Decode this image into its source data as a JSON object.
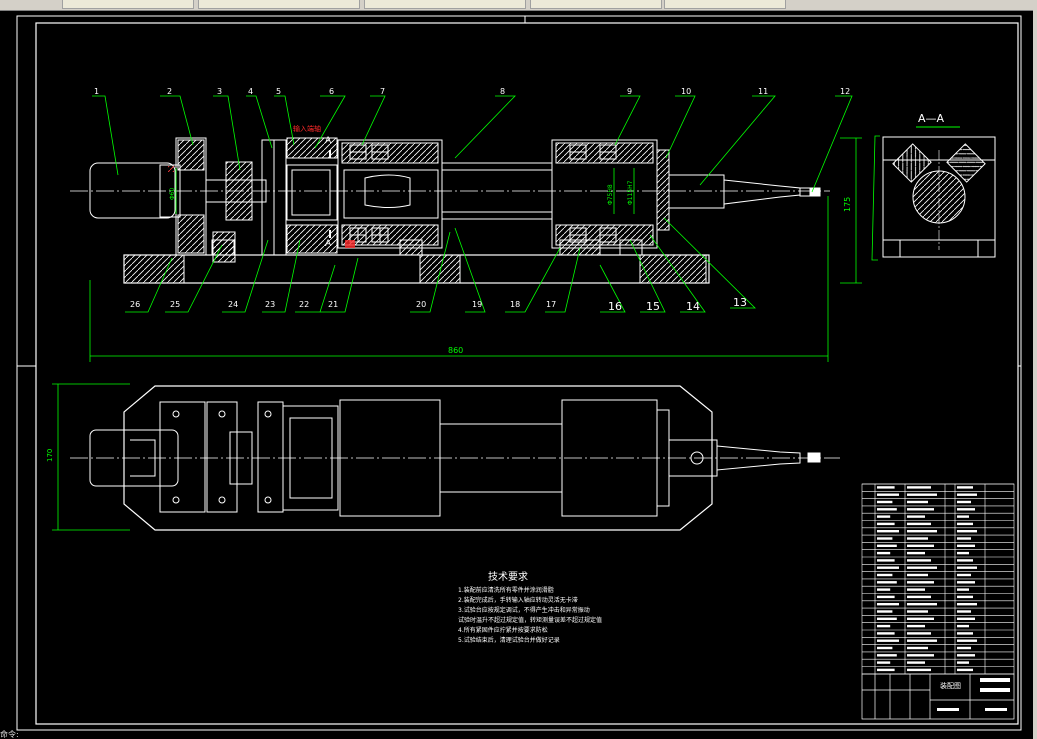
{
  "drawing": {
    "part_numbers": [
      "1",
      "2",
      "3",
      "4",
      "5",
      "6",
      "7",
      "8",
      "9",
      "10",
      "11",
      "12",
      "13",
      "14",
      "15",
      "16",
      "17",
      "18",
      "19",
      "20",
      "21",
      "22",
      "23",
      "24",
      "25",
      "26"
    ],
    "section_mark": "A",
    "section_view_title": "A—A",
    "red_note": "输入端轴",
    "dim_total_length": "860",
    "dim_height": "175",
    "dim_plan_width": "170",
    "dim_diam_1": "Φ60",
    "dim_diam_2": "Φ75H8",
    "dim_diam_3": "Φ115H7"
  },
  "tech_requirements": {
    "title": "技术要求",
    "lines": [
      "1.装配前应清洗所有零件并涂润滑脂",
      "2.装配完成后，手转输入轴应转动灵活无卡滞",
      "3.试验台应按规定调试，不得产生冲击和异常振动",
      "  试验时温升不超过规定值，转矩测量误差不超过规定值",
      "4.所有紧固件应拧紧并按要求防松",
      "5.试验结束后，清理试验台并做好记录"
    ]
  },
  "title_block": {
    "name": "装配图"
  },
  "status_text": "命令:",
  "colors": {
    "line_white": "#ffffff",
    "line_green": "#00ff00",
    "line_red": "#ff0000",
    "line_cyan": "#00ffff",
    "background": "#000000"
  }
}
